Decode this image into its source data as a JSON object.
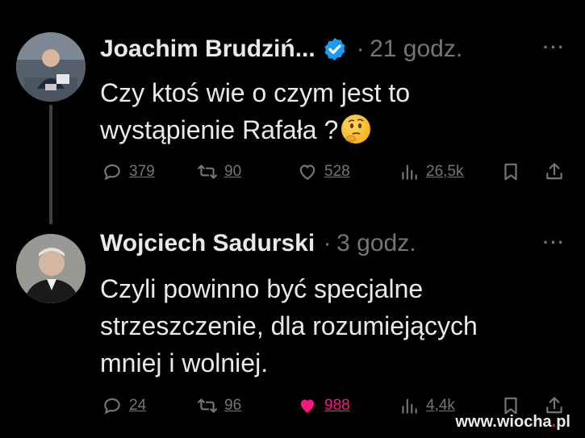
{
  "tweets": [
    {
      "author": "Joachim Brudziń...",
      "verified": true,
      "separator": "·",
      "time": "21 godz.",
      "more": "···",
      "text_line1": "Czy ktoś wie o czym jest to",
      "text_line2": "wystąpienie Rafała ?",
      "emoji": "thinking-face",
      "replies": "379",
      "retweets": "90",
      "likes": "528",
      "views": "26,5k"
    },
    {
      "author": "Wojciech Sadurski",
      "verified": false,
      "separator": "·",
      "time": "3 godz.",
      "more": "···",
      "text_line1": "Czyli powinno być specjalne",
      "text_line2": "strzeszczenie, dla rozumiejących",
      "text_line3": "mniej i wolniej.",
      "replies": "24",
      "retweets": "96",
      "likes": "988",
      "views": "4,4k",
      "liked": true
    }
  ],
  "colors": {
    "background": "#000000",
    "text": "#e7e9ea",
    "muted": "#71767b",
    "verified": "#1d9bf0",
    "like": "#f91880"
  },
  "watermark": {
    "prefix": "www.",
    "name": "wiocha",
    "dot": ".",
    "suffix": "pl"
  }
}
